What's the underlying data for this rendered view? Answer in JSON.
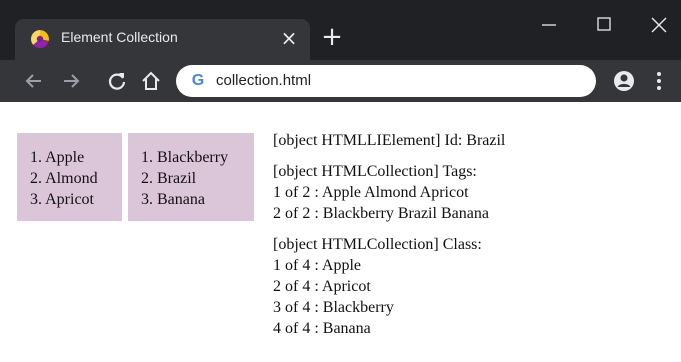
{
  "window": {
    "tab_title": "Element Collection",
    "url": "collection.html"
  },
  "icons": [
    "chrome-favicon",
    "close-icon",
    "plus-icon",
    "minimize-icon",
    "maximize-icon",
    "window-close-icon",
    "back-arrow-icon",
    "forward-arrow-icon",
    "reload-icon",
    "home-icon",
    "google-g-icon",
    "profile-icon",
    "kebab-menu-icon"
  ],
  "page": {
    "list1": [
      "1. Apple",
      "2. Almond",
      "3. Apricot"
    ],
    "list2": [
      "1. Blackberry",
      "2. Brazil",
      "3. Banana"
    ],
    "output": {
      "id_line": "[object HTMLLIElement] Id: Brazil",
      "tags_header": "[object HTMLCollection] Tags:",
      "tags": [
        "1 of 2 : Apple Almond Apricot",
        "2 of 2 : Blackberry Brazil Banana"
      ],
      "class_header": "[object HTMLCollection] Class:",
      "classes": [
        "1 of 4 : Apple",
        "2 of 4 : Apricot",
        "3 of 4 : Blackberry",
        "4 of 4 : Banana"
      ]
    }
  }
}
